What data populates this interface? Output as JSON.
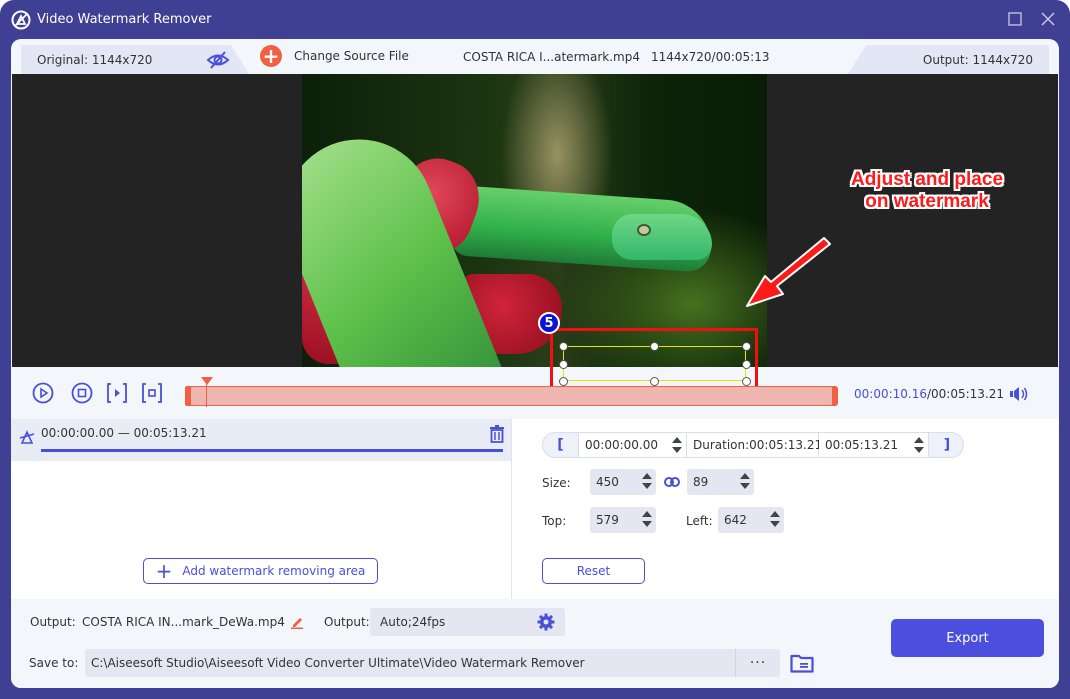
{
  "window": {
    "title": "Video Watermark Remover"
  },
  "header": {
    "original_label": "Original: 1144x720",
    "change_source_label": "Change Source File",
    "file_name": "COSTA RICA I...atermark.mp4",
    "file_dims_duration": "1144x720/00:05:13",
    "output_label": "Output: 1144x720"
  },
  "preview": {
    "area_badge": "5",
    "annotation_line1": "Adjust and place",
    "annotation_line2": "on watermark"
  },
  "playback": {
    "current_time": "00:00:10.16",
    "separator": "/",
    "total_time": "00:05:13.21",
    "playhead_fraction": 0.032
  },
  "areas": {
    "items": [
      {
        "start": "00:00:00.00",
        "dash": "—",
        "end": "00:05:13.21"
      }
    ],
    "add_button_label": "Add watermark removing area"
  },
  "settings": {
    "start_time": "00:00:00.00",
    "duration": "Duration:00:05:13.21",
    "end_time": "00:05:13.21",
    "open_bracket": "[",
    "close_bracket": "]",
    "size_label": "Size:",
    "width": "450",
    "height": "89",
    "top_label": "Top:",
    "top": "579",
    "left_label": "Left:",
    "left": "642",
    "reset_label": "Reset"
  },
  "bottom": {
    "output_label": "Output:",
    "output_file": "COSTA RICA IN...mark_DeWa.mp4",
    "output_format_label": "Output:",
    "output_format": "Auto;24fps",
    "save_to_label": "Save to:",
    "save_path": "C:\\Aiseesoft Studio\\Aiseesoft Video Converter Ultimate\\Video Watermark Remover",
    "more_label": "···",
    "export_label": "Export"
  },
  "colors": {
    "accent": "#4a4fd8",
    "titlebar": "#3f3f94",
    "timeline": "#f06043",
    "selection": "#ee1111"
  }
}
